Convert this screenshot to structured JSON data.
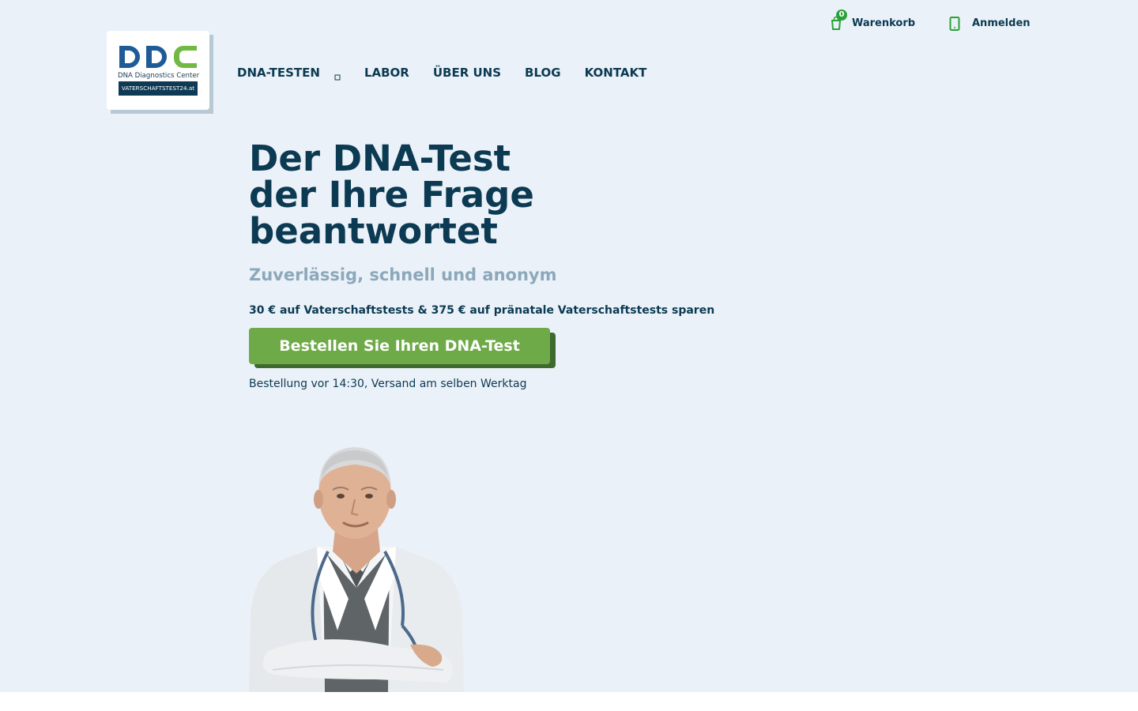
{
  "header": {
    "cart": {
      "icon": "cart-icon",
      "count": "0",
      "label": "Warenkorb"
    },
    "login": {
      "icon": "user-icon",
      "label": "Anmelden"
    }
  },
  "logo": {
    "mark": "DDC",
    "subtitle": "DNA Diagnostics Center",
    "bar_text": "VATERSCHAFTSTEST24.at"
  },
  "nav": {
    "items": [
      {
        "label": "DNA-TESTEN",
        "has_dropdown": true
      },
      {
        "label": "LABOR"
      },
      {
        "label": "ÜBER UNS"
      },
      {
        "label": "BLOG"
      },
      {
        "label": "KONTAKT"
      }
    ]
  },
  "hero": {
    "title_lines": [
      "Der DNA-Test",
      "der Ihre Frage",
      "beantwortet"
    ],
    "subtitle": "Zuverlässig, schnell und anonym",
    "promo": "30 € auf Vaterschaftstests & 375 € auf pränatale Vaterschaftstests sparen",
    "cta_label": "Bestellen Sie Ihren DNA-Test",
    "shipping_note": "Bestellung vor 14:30, Versand am selben Werktag"
  },
  "colors": {
    "background": "#ebf1f8",
    "primary_text": "#0b3a52",
    "subtitle_text": "#8ca8bb",
    "accent_green": "#6eaa48",
    "icon_green": "#2aa23a",
    "logo_blue": "#1f5c97",
    "logo_green": "#72b944"
  }
}
